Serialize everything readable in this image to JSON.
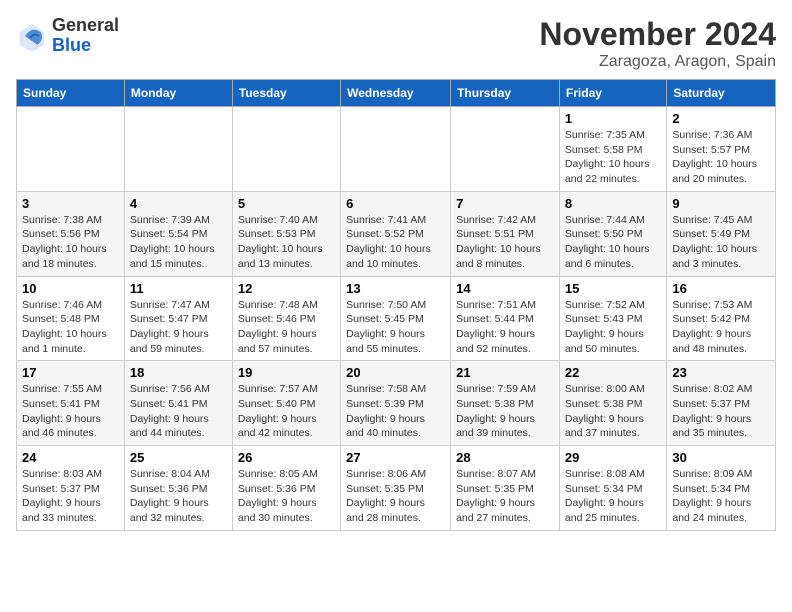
{
  "header": {
    "logo_general": "General",
    "logo_blue": "Blue",
    "month_title": "November 2024",
    "location": "Zaragoza, Aragon, Spain"
  },
  "days_of_week": [
    "Sunday",
    "Monday",
    "Tuesday",
    "Wednesday",
    "Thursday",
    "Friday",
    "Saturday"
  ],
  "weeks": [
    [
      {
        "day": "",
        "info": ""
      },
      {
        "day": "",
        "info": ""
      },
      {
        "day": "",
        "info": ""
      },
      {
        "day": "",
        "info": ""
      },
      {
        "day": "",
        "info": ""
      },
      {
        "day": "1",
        "info": "Sunrise: 7:35 AM\nSunset: 5:58 PM\nDaylight: 10 hours and 22 minutes."
      },
      {
        "day": "2",
        "info": "Sunrise: 7:36 AM\nSunset: 5:57 PM\nDaylight: 10 hours and 20 minutes."
      }
    ],
    [
      {
        "day": "3",
        "info": "Sunrise: 7:38 AM\nSunset: 5:56 PM\nDaylight: 10 hours and 18 minutes."
      },
      {
        "day": "4",
        "info": "Sunrise: 7:39 AM\nSunset: 5:54 PM\nDaylight: 10 hours and 15 minutes."
      },
      {
        "day": "5",
        "info": "Sunrise: 7:40 AM\nSunset: 5:53 PM\nDaylight: 10 hours and 13 minutes."
      },
      {
        "day": "6",
        "info": "Sunrise: 7:41 AM\nSunset: 5:52 PM\nDaylight: 10 hours and 10 minutes."
      },
      {
        "day": "7",
        "info": "Sunrise: 7:42 AM\nSunset: 5:51 PM\nDaylight: 10 hours and 8 minutes."
      },
      {
        "day": "8",
        "info": "Sunrise: 7:44 AM\nSunset: 5:50 PM\nDaylight: 10 hours and 6 minutes."
      },
      {
        "day": "9",
        "info": "Sunrise: 7:45 AM\nSunset: 5:49 PM\nDaylight: 10 hours and 3 minutes."
      }
    ],
    [
      {
        "day": "10",
        "info": "Sunrise: 7:46 AM\nSunset: 5:48 PM\nDaylight: 10 hours and 1 minute."
      },
      {
        "day": "11",
        "info": "Sunrise: 7:47 AM\nSunset: 5:47 PM\nDaylight: 9 hours and 59 minutes."
      },
      {
        "day": "12",
        "info": "Sunrise: 7:48 AM\nSunset: 5:46 PM\nDaylight: 9 hours and 57 minutes."
      },
      {
        "day": "13",
        "info": "Sunrise: 7:50 AM\nSunset: 5:45 PM\nDaylight: 9 hours and 55 minutes."
      },
      {
        "day": "14",
        "info": "Sunrise: 7:51 AM\nSunset: 5:44 PM\nDaylight: 9 hours and 52 minutes."
      },
      {
        "day": "15",
        "info": "Sunrise: 7:52 AM\nSunset: 5:43 PM\nDaylight: 9 hours and 50 minutes."
      },
      {
        "day": "16",
        "info": "Sunrise: 7:53 AM\nSunset: 5:42 PM\nDaylight: 9 hours and 48 minutes."
      }
    ],
    [
      {
        "day": "17",
        "info": "Sunrise: 7:55 AM\nSunset: 5:41 PM\nDaylight: 9 hours and 46 minutes."
      },
      {
        "day": "18",
        "info": "Sunrise: 7:56 AM\nSunset: 5:41 PM\nDaylight: 9 hours and 44 minutes."
      },
      {
        "day": "19",
        "info": "Sunrise: 7:57 AM\nSunset: 5:40 PM\nDaylight: 9 hours and 42 minutes."
      },
      {
        "day": "20",
        "info": "Sunrise: 7:58 AM\nSunset: 5:39 PM\nDaylight: 9 hours and 40 minutes."
      },
      {
        "day": "21",
        "info": "Sunrise: 7:59 AM\nSunset: 5:38 PM\nDaylight: 9 hours and 39 minutes."
      },
      {
        "day": "22",
        "info": "Sunrise: 8:00 AM\nSunset: 5:38 PM\nDaylight: 9 hours and 37 minutes."
      },
      {
        "day": "23",
        "info": "Sunrise: 8:02 AM\nSunset: 5:37 PM\nDaylight: 9 hours and 35 minutes."
      }
    ],
    [
      {
        "day": "24",
        "info": "Sunrise: 8:03 AM\nSunset: 5:37 PM\nDaylight: 9 hours and 33 minutes."
      },
      {
        "day": "25",
        "info": "Sunrise: 8:04 AM\nSunset: 5:36 PM\nDaylight: 9 hours and 32 minutes."
      },
      {
        "day": "26",
        "info": "Sunrise: 8:05 AM\nSunset: 5:36 PM\nDaylight: 9 hours and 30 minutes."
      },
      {
        "day": "27",
        "info": "Sunrise: 8:06 AM\nSunset: 5:35 PM\nDaylight: 9 hours and 28 minutes."
      },
      {
        "day": "28",
        "info": "Sunrise: 8:07 AM\nSunset: 5:35 PM\nDaylight: 9 hours and 27 minutes."
      },
      {
        "day": "29",
        "info": "Sunrise: 8:08 AM\nSunset: 5:34 PM\nDaylight: 9 hours and 25 minutes."
      },
      {
        "day": "30",
        "info": "Sunrise: 8:09 AM\nSunset: 5:34 PM\nDaylight: 9 hours and 24 minutes."
      }
    ]
  ]
}
